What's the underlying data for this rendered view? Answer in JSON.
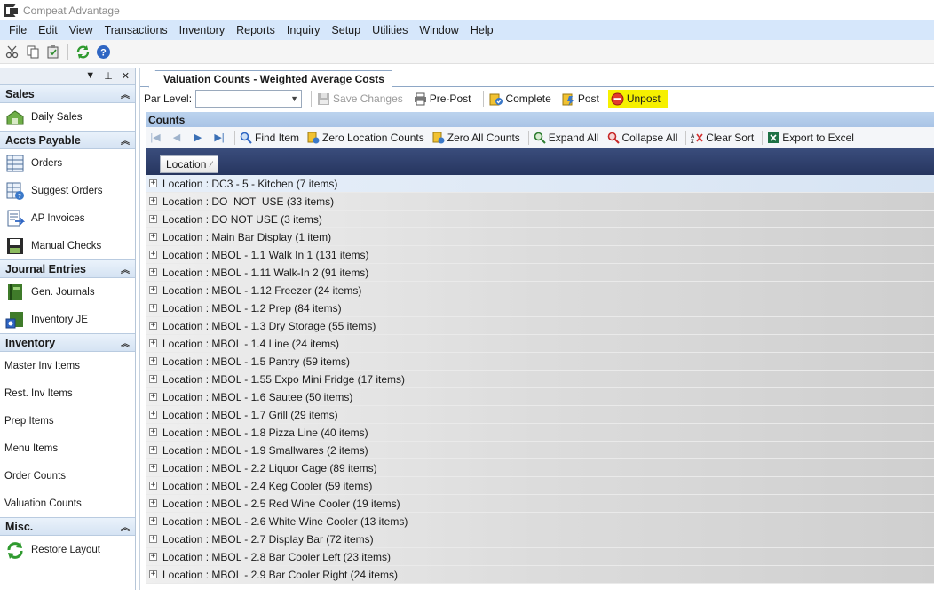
{
  "window": {
    "title": "Compeat Advantage"
  },
  "menubar": {
    "items": [
      "File",
      "Edit",
      "View",
      "Transactions",
      "Inventory",
      "Reports",
      "Inquiry",
      "Setup",
      "Utilities",
      "Window",
      "Help"
    ]
  },
  "toolbar": {
    "icons": [
      "cut-icon",
      "copy-icon",
      "paste-icon",
      "refresh-icon",
      "help-icon"
    ]
  },
  "sidebar": {
    "header_controls": [
      "▼",
      "⊥",
      "✕"
    ],
    "groups": [
      {
        "title": "Sales",
        "items": [
          {
            "label": "Daily Sales",
            "icon": "daily-sales-icon"
          }
        ]
      },
      {
        "title": "Accts Payable",
        "items": [
          {
            "label": "Orders",
            "icon": "orders-icon"
          },
          {
            "label": "Suggest Orders",
            "icon": "suggest-orders-icon"
          },
          {
            "label": "AP Invoices",
            "icon": "ap-invoices-icon"
          },
          {
            "label": "Manual Checks",
            "icon": "manual-checks-icon"
          }
        ]
      },
      {
        "title": "Journal Entries",
        "items": [
          {
            "label": "Gen. Journals",
            "icon": "journal-icon"
          },
          {
            "label": "Inventory JE",
            "icon": "inventory-je-icon"
          }
        ]
      },
      {
        "title": "Inventory",
        "items": [
          {
            "label": "Master Inv Items"
          },
          {
            "label": "Rest. Inv Items"
          },
          {
            "label": "Prep Items"
          },
          {
            "label": "Menu Items"
          },
          {
            "label": "Order Counts"
          },
          {
            "label": "Valuation Counts"
          }
        ]
      },
      {
        "title": "Misc.",
        "items": [
          {
            "label": "Restore Layout",
            "icon": "restore-layout-icon"
          }
        ]
      }
    ]
  },
  "main": {
    "tab_title": "Valuation Counts - Weighted Average Costs",
    "par_level_label": "Par Level:",
    "par_level_value": "",
    "actions": {
      "save_changes": "Save Changes",
      "pre_post": "Pre-Post",
      "complete": "Complete",
      "post": "Post",
      "unpost": "Unpost"
    },
    "counts_title": "Counts",
    "grid_toolbar": {
      "find_item": "Find Item",
      "zero_location_counts": "Zero Location Counts",
      "zero_all_counts": "Zero All Counts",
      "expand_all": "Expand All",
      "collapse_all": "Collapse All",
      "clear_sort": "Clear Sort",
      "export_to_excel": "Export to Excel"
    },
    "group_by_column": "Location",
    "rows": [
      "Location : DC3 - 5 - Kitchen (7 items)",
      "Location : DO  NOT  USE (33 items)",
      "Location : DO NOT USE (3 items)",
      "Location : Main Bar Display (1 item)",
      "Location : MBOL - 1.1 Walk In 1 (131 items)",
      "Location : MBOL - 1.11 Walk-In 2 (91 items)",
      "Location : MBOL - 1.12 Freezer (24 items)",
      "Location : MBOL - 1.2 Prep (84 items)",
      "Location : MBOL - 1.3 Dry Storage (55 items)",
      "Location : MBOL - 1.4 Line (24 items)",
      "Location : MBOL - 1.5 Pantry (59 items)",
      "Location : MBOL - 1.55 Expo Mini Fridge (17 items)",
      "Location : MBOL - 1.6 Sautee (50 items)",
      "Location : MBOL - 1.7 Grill (29 items)",
      "Location : MBOL - 1.8 Pizza Line (40 items)",
      "Location : MBOL - 1.9 Smallwares (2 items)",
      "Location : MBOL - 2.2 Liquor Cage (89 items)",
      "Location : MBOL - 2.4 Keg Cooler (59 items)",
      "Location : MBOL - 2.5 Red Wine Cooler (19 items)",
      "Location : MBOL - 2.6 White Wine Cooler (13 items)",
      "Location : MBOL - 2.7 Display Bar (72 items)",
      "Location : MBOL - 2.8 Bar Cooler Left (23 items)",
      "Location : MBOL - 2.9 Bar Cooler Right (24 items)"
    ]
  },
  "colors": {
    "menubar_bg": "#d6e7fb",
    "counts_header_bg": "#bcd3ee",
    "groupby_bg": "#2f3f6b",
    "unpost_highlight": "#f6f000"
  }
}
